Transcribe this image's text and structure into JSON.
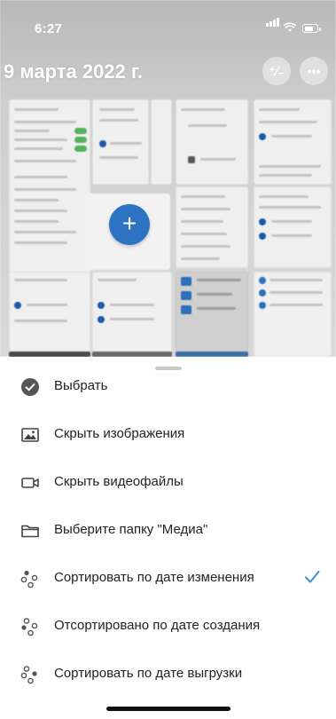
{
  "status_bar": {
    "time": "6:27"
  },
  "header": {
    "date_title": "9 марта 2022 г.",
    "sort_button_label": "⁺∕₋",
    "more_button_label": "•••"
  },
  "menu": {
    "items": [
      {
        "label": "Выбрать",
        "icon": "checkmark-circle-icon",
        "checked": false
      },
      {
        "label": "Скрыть изображения",
        "icon": "image-icon",
        "checked": false
      },
      {
        "label": "Скрыть видеофайлы",
        "icon": "video-camera-icon",
        "checked": false
      },
      {
        "label": "Выберите папку \"Медиа\"",
        "icon": "folder-icon",
        "checked": false
      },
      {
        "label": "Сортировать по дате изменения",
        "icon": "sort-icon",
        "checked": true
      },
      {
        "label": "Отсортировано по дате создания",
        "icon": "sort-icon",
        "checked": false
      },
      {
        "label": "Сортировать по дате выгрузки",
        "icon": "sort-icon",
        "checked": false
      }
    ]
  },
  "colors": {
    "accent": "#2e72c2",
    "check": "#3b8de0"
  }
}
